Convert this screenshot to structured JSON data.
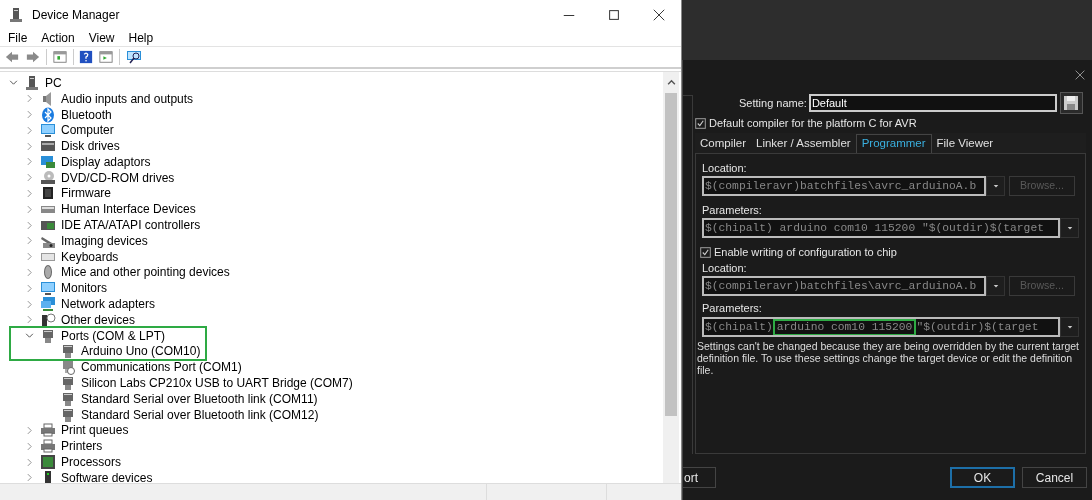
{
  "device_manager": {
    "title": "Device Manager",
    "menu": [
      "File",
      "Action",
      "View",
      "Help"
    ],
    "tree": {
      "label": "PC",
      "expanded": true,
      "children": [
        {
          "label": "Audio inputs and outputs",
          "expanded": false
        },
        {
          "label": "Bluetooth",
          "expanded": false
        },
        {
          "label": "Computer",
          "expanded": false
        },
        {
          "label": "Disk drives",
          "expanded": false
        },
        {
          "label": "Display adaptors",
          "expanded": false
        },
        {
          "label": "DVD/CD-ROM drives",
          "expanded": false
        },
        {
          "label": "Firmware",
          "expanded": false
        },
        {
          "label": "Human Interface Devices",
          "expanded": false
        },
        {
          "label": "IDE ATA/ATAPI controllers",
          "expanded": false
        },
        {
          "label": "Imaging devices",
          "expanded": false
        },
        {
          "label": "Keyboards",
          "expanded": false
        },
        {
          "label": "Mice and other pointing devices",
          "expanded": false
        },
        {
          "label": "Monitors",
          "expanded": false
        },
        {
          "label": "Network adapters",
          "expanded": false
        },
        {
          "label": "Other devices",
          "expanded": false
        },
        {
          "label": "Ports (COM & LPT)",
          "expanded": true,
          "highlighted": true,
          "children": [
            {
              "label": "Arduino Uno (COM10)",
              "highlighted": true
            },
            {
              "label": "Communications Port (COM1)"
            },
            {
              "label": "Silicon Labs CP210x USB to UART Bridge (COM7)"
            },
            {
              "label": "Standard Serial over Bluetooth link (COM11)"
            },
            {
              "label": "Standard Serial over Bluetooth link (COM12)"
            }
          ]
        },
        {
          "label": "Print queues",
          "expanded": false
        },
        {
          "label": "Printers",
          "expanded": false
        },
        {
          "label": "Processors",
          "expanded": false
        },
        {
          "label": "Software devices",
          "expanded": false
        }
      ]
    }
  },
  "compiler_dialog": {
    "setting_name_label": "Setting name:",
    "setting_name": "Default",
    "default_compiler": {
      "label": "Default compiler for the platform C for AVR",
      "checked": true
    },
    "tabs": [
      {
        "label": "Compiler",
        "selected": false
      },
      {
        "label": "Linker / Assembler",
        "selected": false
      },
      {
        "label": "Programmer",
        "selected": true
      },
      {
        "label": "File Viewer",
        "selected": false
      }
    ],
    "location_label": "Location:",
    "location": "$(compileravr)batchfiles\\avrc_arduinoA.b",
    "browse": "Browse...",
    "parameters_label": "Parameters:",
    "parameters": [
      {
        "text": "$(chipalt) arduino com10 115200 \"$(outdir)$(target"
      }
    ],
    "enable_config": {
      "label": "Enable writing of configuration to chip",
      "checked": true
    },
    "config_location_label": "Location:",
    "config_location": "$(compileravr)batchfiles\\avrc_arduinoA.b",
    "config_browse": "Browse...",
    "config_parameters_label": "Parameters:",
    "config_parameters": [
      {
        "text": "$(chipalt)"
      },
      {
        "text": "arduino com10 115200",
        "highlighted": true
      },
      {
        "text": "\"$(outdir)$(target"
      }
    ],
    "notice": "Settings can't be changed because they are being overridden by the current target definition file. To use these settings change the target device or edit the definition file.",
    "buttons": [
      {
        "label": "ort",
        "kind": "plain"
      },
      {
        "label": "OK",
        "kind": "default"
      },
      {
        "label": "Cancel",
        "kind": "plain"
      }
    ]
  }
}
